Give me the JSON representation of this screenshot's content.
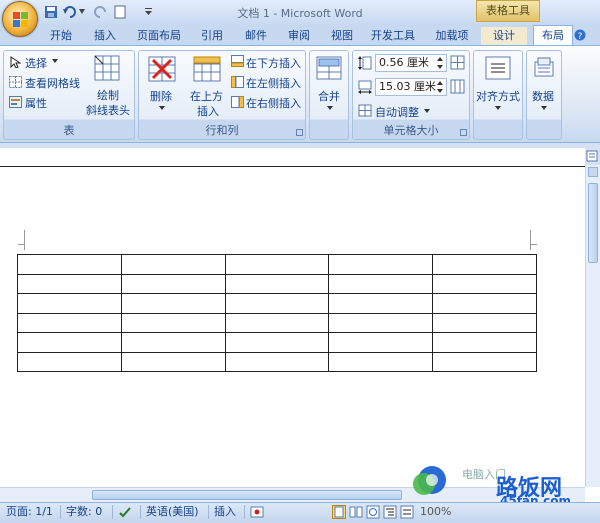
{
  "window": {
    "title": "文档 1 - Microsoft Word"
  },
  "context": {
    "label": "表格工具"
  },
  "tabs": [
    "开始",
    "插入",
    "页面布局",
    "引用",
    "邮件",
    "审阅",
    "视图",
    "开发工具",
    "加载项",
    "设计",
    "布局"
  ],
  "ribbon": {
    "group_table": {
      "label": "表",
      "select": "选择",
      "gridlines": "查看网格线",
      "props": "属性",
      "draw_line1": "绘制",
      "draw_line2": "斜线表头"
    },
    "group_rows": {
      "label": "行和列",
      "delete": "删除",
      "insert_above1": "在上方",
      "insert_above2": "插入",
      "insert_below": "在下方插入",
      "insert_left": "在左侧插入",
      "insert_right": "在右侧插入"
    },
    "group_merge": {
      "merge": "合并"
    },
    "group_size": {
      "label": "单元格大小",
      "height": "0.56 厘米",
      "width": "15.03 厘米",
      "autofit": "自动调整"
    },
    "align": "对齐方式",
    "data": "数据"
  },
  "table": {
    "rows": 6,
    "cols": 5
  },
  "status": {
    "page": "页面: 1/1",
    "words": "字数: 0",
    "lang": "英语(美国)",
    "mode": "插入",
    "zoom": "100%"
  },
  "watermark": {
    "text": "路饭网",
    "url": "45fan.com",
    "prefix": "电脑入门"
  }
}
